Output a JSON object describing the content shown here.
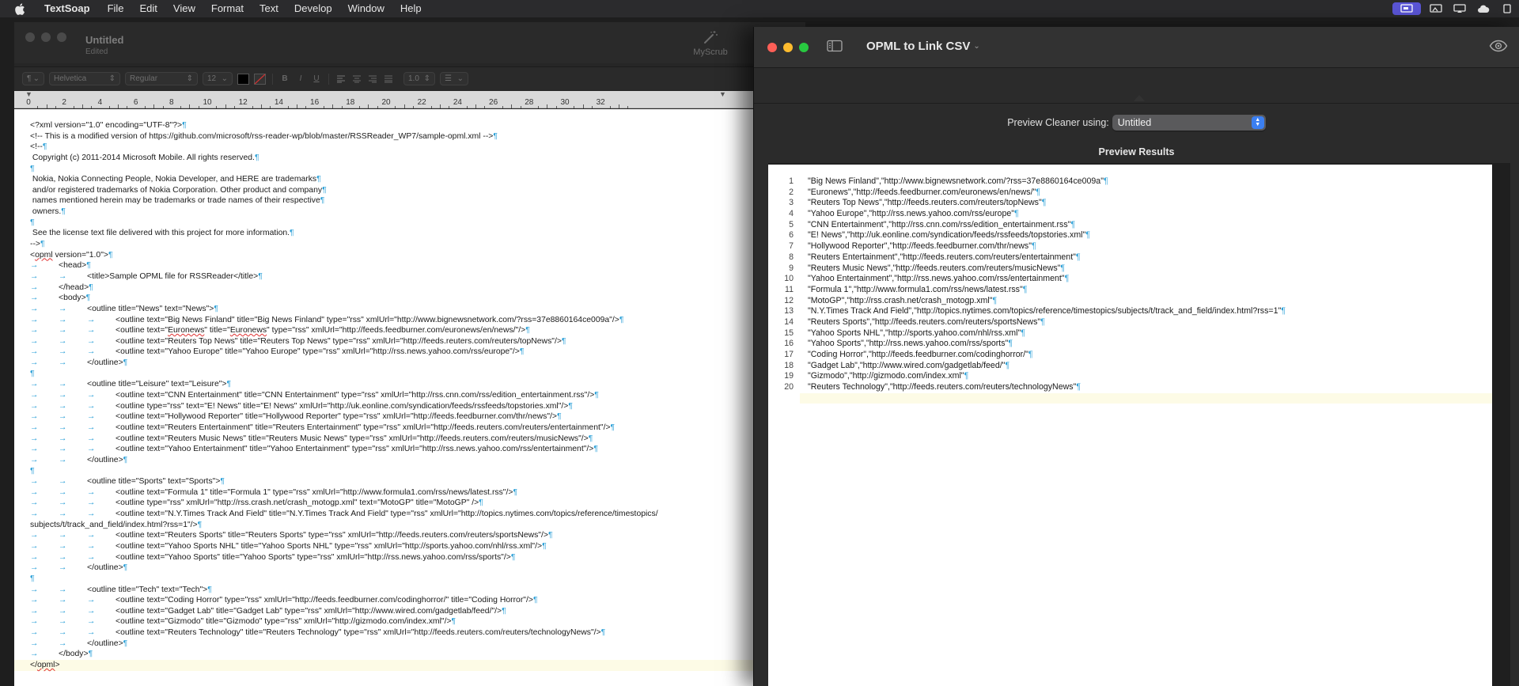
{
  "menubar": {
    "app_name": "TextSoap",
    "items": [
      "File",
      "Edit",
      "View",
      "Format",
      "Text",
      "Develop",
      "Window",
      "Help"
    ]
  },
  "doc_window": {
    "title": "Untitled",
    "subtitle": "Edited",
    "myscrub_label": "MyScrub",
    "format_bar": {
      "paragraph_style": "¶",
      "font_family": "Helvetica",
      "font_style": "Regular",
      "font_size": "12",
      "line_spacing": "1.0",
      "bold": "B",
      "italic": "I",
      "underline": "U"
    },
    "ruler_labels": [
      "0",
      "2",
      "4",
      "6",
      "8",
      "10",
      "12",
      "14",
      "16",
      "18",
      "20",
      "22",
      "24",
      "26",
      "28",
      "30",
      "32"
    ],
    "lines": [
      "<?xml version=\"1.0\" encoding=\"UTF-8\"?>",
      "<!-- This is a modified version of https://github.com/microsoft/rss-reader-wp/blob/master/RSSReader_WP7/sample-opml.xml -->",
      "<!--",
      " Copyright (c) 2011-2014 Microsoft Mobile. All rights reserved.",
      "",
      " Nokia, Nokia Connecting People, Nokia Developer, and HERE are trademarks",
      " and/or registered trademarks of Nokia Corporation. Other product and company",
      " names mentioned herein may be trademarks or trade names of their respective",
      " owners.",
      "",
      " See the license text file delivered with this project for more information.",
      "-->",
      "<opml version=\"1.0\">",
      "\t<head>",
      "\t\t<title>Sample OPML file for RSSReader</title>",
      "\t</head>",
      "\t<body>",
      "\t\t<outline title=\"News\" text=\"News\">",
      "\t\t\t<outline text=\"Big News Finland\" title=\"Big News Finland\" type=\"rss\" xmlUrl=\"http://www.bignewsnetwork.com/?rss=37e8860164ce009a\"/>",
      "\t\t\t<outline text=\"Euronews\" title=\"Euronews\" type=\"rss\" xmlUrl=\"http://feeds.feedburner.com/euronews/en/news/\"/>",
      "\t\t\t<outline text=\"Reuters Top News\" title=\"Reuters Top News\" type=\"rss\" xmlUrl=\"http://feeds.reuters.com/reuters/topNews\"/>",
      "\t\t\t<outline text=\"Yahoo Europe\" title=\"Yahoo Europe\" type=\"rss\" xmlUrl=\"http://rss.news.yahoo.com/rss/europe\"/>",
      "\t\t</outline>",
      "",
      "\t\t<outline title=\"Leisure\" text=\"Leisure\">",
      "\t\t\t<outline text=\"CNN Entertainment\" title=\"CNN Entertainment\" type=\"rss\" xmlUrl=\"http://rss.cnn.com/rss/edition_entertainment.rss\"/>",
      "\t\t\t<outline type=\"rss\" text=\"E! News\" title=\"E! News\" xmlUrl=\"http://uk.eonline.com/syndication/feeds/rssfeeds/topstories.xml\"/>",
      "\t\t\t<outline text=\"Hollywood Reporter\" title=\"Hollywood Reporter\" type=\"rss\" xmlUrl=\"http://feeds.feedburner.com/thr/news\"/>",
      "\t\t\t<outline text=\"Reuters Entertainment\" title=\"Reuters Entertainment\" type=\"rss\" xmlUrl=\"http://feeds.reuters.com/reuters/entertainment\"/>",
      "\t\t\t<outline text=\"Reuters Music News\" title=\"Reuters Music News\" type=\"rss\" xmlUrl=\"http://feeds.reuters.com/reuters/musicNews\"/>",
      "\t\t\t<outline text=\"Yahoo Entertainment\" title=\"Yahoo Entertainment\" type=\"rss\" xmlUrl=\"http://rss.news.yahoo.com/rss/entertainment\"/>",
      "\t\t</outline>",
      "",
      "\t\t<outline title=\"Sports\" text=\"Sports\">",
      "\t\t\t<outline text=\"Formula 1\" title=\"Formula 1\" type=\"rss\" xmlUrl=\"http://www.formula1.com/rss/news/latest.rss\"/>",
      "\t\t\t<outline type=\"rss\" xmlUrl=\"http://rss.crash.net/crash_motogp.xml\" text=\"MotoGP\" title=\"MotoGP\" />",
      "\t\t\t<outline text=\"N.Y.Times Track And Field\" title=\"N.Y.Times Track And Field\" type=\"rss\" xmlUrl=\"http://topics.nytimes.com/topics/reference/timestopics/",
      "subjects/t/track_and_field/index.html?rss=1\"/>",
      "\t\t\t<outline text=\"Reuters Sports\" title=\"Reuters Sports\" type=\"rss\" xmlUrl=\"http://feeds.reuters.com/reuters/sportsNews\"/>",
      "\t\t\t<outline text=\"Yahoo Sports NHL\" title=\"Yahoo Sports NHL\" type=\"rss\" xmlUrl=\"http://sports.yahoo.com/nhl/rss.xml\"/>",
      "\t\t\t<outline text=\"Yahoo Sports\" title=\"Yahoo Sports\" type=\"rss\" xmlUrl=\"http://rss.news.yahoo.com/rss/sports\"/>",
      "\t\t</outline>",
      "",
      "\t\t<outline title=\"Tech\" text=\"Tech\">",
      "\t\t\t<outline text=\"Coding Horror\" type=\"rss\" xmlUrl=\"http://feeds.feedburner.com/codinghorror/\" title=\"Coding Horror\"/>",
      "\t\t\t<outline text=\"Gadget Lab\" title=\"Gadget Lab\" type=\"rss\" xmlUrl=\"http://www.wired.com/gadgetlab/feed/\"/>",
      "\t\t\t<outline text=\"Gizmodo\" title=\"Gizmodo\" type=\"rss\" xmlUrl=\"http://gizmodo.com/index.xml\"/>",
      "\t\t\t<outline text=\"Reuters Technology\" title=\"Reuters Technology\" type=\"rss\" xmlUrl=\"http://feeds.reuters.com/reuters/technologyNews\"/>",
      "\t\t</outline>",
      "\t</body>",
      "</opml>"
    ]
  },
  "preview_window": {
    "title": "OPML to Link CSV",
    "preview_cleaner_label": "Preview Cleaner using:",
    "cleaner_selected": "Untitled",
    "results_title": "Preview Results",
    "results": [
      "\"Big News Finland\",\"http://www.bignewsnetwork.com/?rss=37e8860164ce009a\"",
      "\"Euronews\",\"http://feeds.feedburner.com/euronews/en/news/\"",
      "\"Reuters Top News\",\"http://feeds.reuters.com/reuters/topNews\"",
      "\"Yahoo Europe\",\"http://rss.news.yahoo.com/rss/europe\"",
      "\"CNN Entertainment\",\"http://rss.cnn.com/rss/edition_entertainment.rss\"",
      "\"E! News\",\"http://uk.eonline.com/syndication/feeds/rssfeeds/topstories.xml\"",
      "\"Hollywood Reporter\",\"http://feeds.feedburner.com/thr/news\"",
      "\"Reuters Entertainment\",\"http://feeds.reuters.com/reuters/entertainment\"",
      "\"Reuters Music News\",\"http://feeds.reuters.com/reuters/musicNews\"",
      "\"Yahoo Entertainment\",\"http://rss.news.yahoo.com/rss/entertainment\"",
      "\"Formula 1\",\"http://www.formula1.com/rss/news/latest.rss\"",
      "\"MotoGP\",\"http://rss.crash.net/crash_motogp.xml\"",
      "\"N.Y.Times Track And Field\",\"http://topics.nytimes.com/topics/reference/timestopics/subjects/t/track_and_field/index.html?rss=1\"",
      "\"Reuters Sports\",\"http://feeds.reuters.com/reuters/sportsNews\"",
      "\"Yahoo Sports NHL\",\"http://sports.yahoo.com/nhl/rss.xml\"",
      "\"Yahoo Sports\",\"http://rss.news.yahoo.com/rss/sports\"",
      "\"Coding Horror\",\"http://feeds.feedburner.com/codinghorror/\"",
      "\"Gadget Lab\",\"http://www.wired.com/gadgetlab/feed/\"",
      "\"Gizmodo\",\"http://gizmodo.com/index.xml\"",
      "\"Reuters Technology\",\"http://feeds.reuters.com/reuters/technologyNews\""
    ]
  },
  "colors": {
    "invisible_marker": "#2ea1d8",
    "select_accent": "#3b7ff1",
    "close": "#fe5f57",
    "minimize": "#febc2e",
    "zoom": "#28c840",
    "current_line": "#fdfbe6"
  },
  "icons": [
    "apple-icon",
    "magic-wand-icon",
    "sidebar-toggle-icon",
    "eye-icon",
    "chevron-down-icon",
    "up-down-arrows-icon"
  ]
}
